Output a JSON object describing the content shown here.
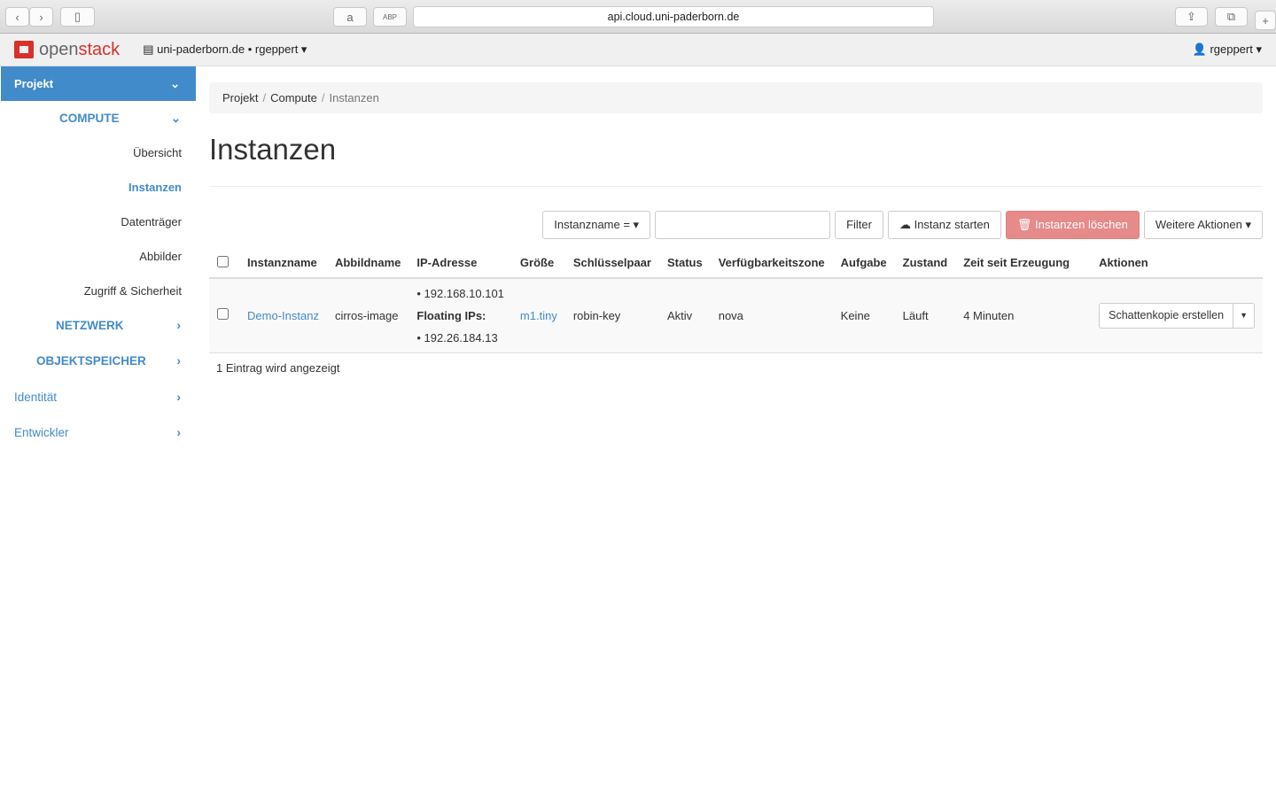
{
  "browser": {
    "url": "api.cloud.uni-paderborn.de"
  },
  "topbar": {
    "logo_a": "open",
    "logo_b": "stack",
    "project": "uni-paderborn.de • rgeppert",
    "user": "rgeppert"
  },
  "sidebar": {
    "projekt": "Projekt",
    "compute": "COMPUTE",
    "items": [
      "Übersicht",
      "Instanzen",
      "Datenträger",
      "Abbilder",
      "Zugriff & Sicherheit"
    ],
    "netzwerk": "NETZWERK",
    "objektspeicher": "OBJEKTSPEICHER",
    "identitaet": "Identität",
    "entwickler": "Entwickler"
  },
  "breadcrumb": [
    "Projekt",
    "Compute",
    "Instanzen"
  ],
  "title": "Instanzen",
  "toolbar": {
    "filter_select": "Instanzname =",
    "search_value": "",
    "filter": "Filter",
    "launch": "Instanz starten",
    "delete": "Instanzen löschen",
    "more": "Weitere Aktionen"
  },
  "table": {
    "headers": [
      "Instanzname",
      "Abbildname",
      "IP-Adresse",
      "Größe",
      "Schlüsselpaar",
      "Status",
      "Verfügbarkeitszone",
      "Aufgabe",
      "Zustand",
      "Zeit seit Erzeugung",
      "Aktionen"
    ],
    "row": {
      "name": "Demo-Instanz",
      "image": "cirros-image",
      "ip": "192.168.10.101",
      "floating_label": "Floating IPs:",
      "floating_ip": "192.26.184.13",
      "size": "m1.tiny",
      "keypair": "robin-key",
      "status": "Aktiv",
      "zone": "nova",
      "task": "Keine",
      "state": "Läuft",
      "age": "4 Minuten",
      "action": "Schattenkopie erstellen"
    }
  },
  "footer": "1 Eintrag wird angezeigt",
  "colors": {
    "accent": "#428bca",
    "danger": "#e68a8a",
    "logo": "#d9302c"
  }
}
